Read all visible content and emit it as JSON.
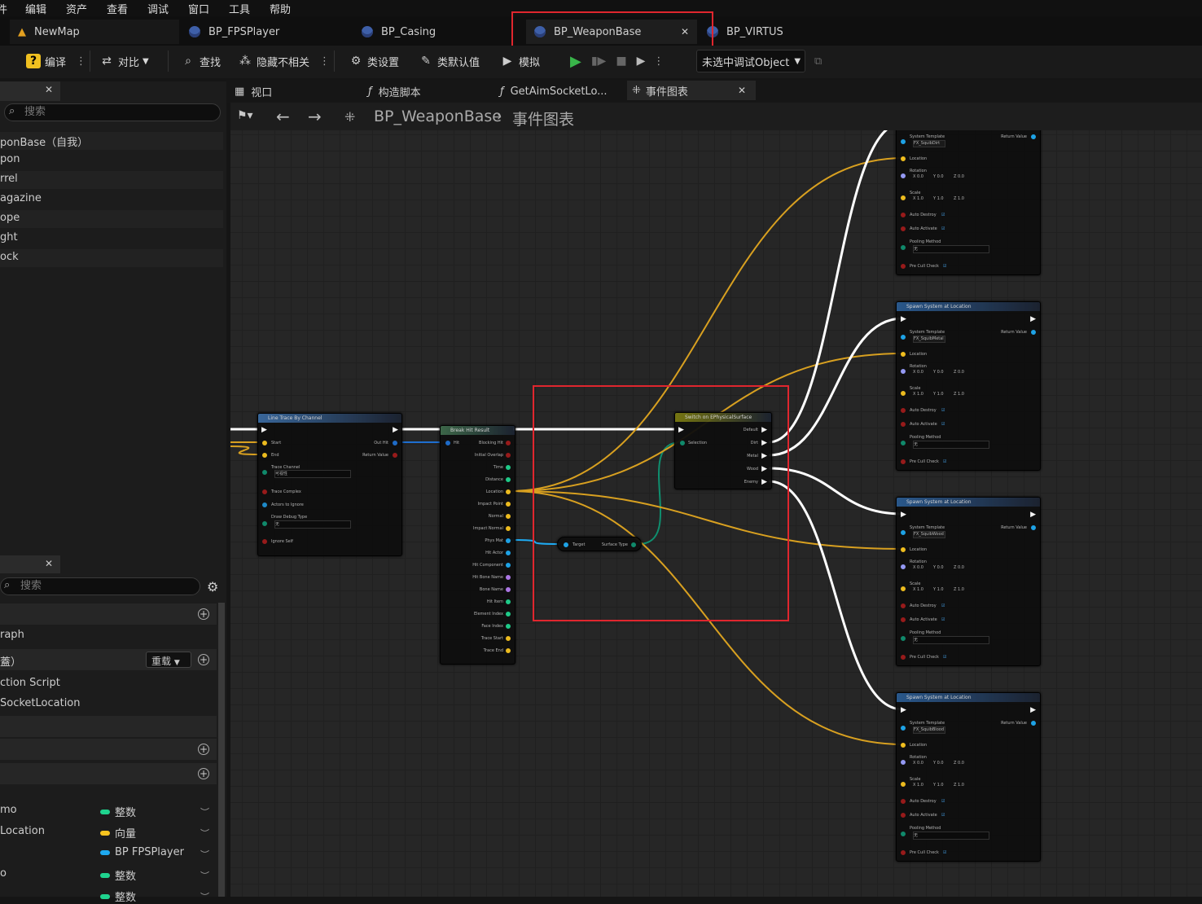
{
  "menu": [
    "件",
    "编辑",
    "资产",
    "查看",
    "调试",
    "窗口",
    "工具",
    "帮助"
  ],
  "tabs": [
    {
      "label": "NewMap"
    },
    {
      "label": "BP_FPSPlayer"
    },
    {
      "label": "BP_Casing"
    },
    {
      "label": "BP_WeaponBase"
    },
    {
      "label": "BP_VIRTUS"
    }
  ],
  "toolbar": {
    "compile": "编译",
    "diff": "对比",
    "find": "查找",
    "hide_unrelated": "隐藏不相关",
    "class_settings": "类设置",
    "class_defaults": "类默认值",
    "simulate": "模拟",
    "debug_object": "未选中调试Object"
  },
  "left_panel": {
    "search_placeholder": "搜索",
    "components": [
      "ponBase（自我）",
      "pon",
      "rrel",
      "agazine",
      "ope",
      "ght",
      "ock"
    ],
    "search2_placeholder": "搜索",
    "mb_rows": [
      "raph",
      "蓋）",
      "ction Script",
      "SocketLocation"
    ],
    "override_label": "重载",
    "variables": [
      {
        "name": "mo",
        "type": "整数",
        "color": "#1fd38e"
      },
      {
        "name": "Location",
        "type": "向量",
        "color": "#f7c31f"
      },
      {
        "name": "",
        "type": "BP FPSPlayer",
        "color": "#1ea9f0"
      },
      {
        "name": "o",
        "type": "整数",
        "color": "#1fd38e"
      },
      {
        "name": "",
        "type": "整数",
        "color": "#1fd38e"
      }
    ]
  },
  "graph_tabs": [
    "视口",
    "构造脚本",
    "GetAimSocketLo...",
    "事件图表"
  ],
  "breadcrumb": {
    "blueprint": "BP_WeaponBase",
    "graph": "事件图表"
  },
  "nodes": {
    "line_trace": {
      "title": "Line Trace By Channel",
      "pins": [
        "Start",
        "End",
        "Trace Channel",
        "Trace Complex",
        "Actors to Ignore",
        "Draw Debug Type",
        "Ignore Self"
      ],
      "out": [
        "Out Hit",
        "Return Value"
      ],
      "channel": "可视性",
      "debug": "无"
    },
    "break_hit": {
      "title": "Break Hit Result",
      "in": "Hit",
      "out": [
        "Blocking Hit",
        "Initial Overlap",
        "Time",
        "Distance",
        "Location",
        "Impact Point",
        "Normal",
        "Impact Normal",
        "Phys Mat",
        "Hit Actor",
        "Hit Component",
        "Hit Bone Name",
        "Bone Name",
        "Hit Item",
        "Element Index",
        "Face Index",
        "Trace Start",
        "Trace End"
      ]
    },
    "surface_type": {
      "in": "Target",
      "out": "Surface Type"
    },
    "switch": {
      "title": "Switch on EPhysicalSurface",
      "in": "Selection",
      "out": [
        "Default",
        "Dirt",
        "Metal",
        "Wood",
        "Enemy"
      ]
    },
    "spawn": {
      "title": "Spawn System at Location",
      "labels": [
        "System Template",
        "Return Value",
        "Location",
        "Rotation",
        "Scale",
        "Auto Destroy",
        "Auto Activate",
        "Pooling Method",
        "Pre Cull Check"
      ],
      "templates": [
        "FX_SquibDirt",
        "FX_SquibMetal",
        "FX_SquibWood",
        "FX_SquibBlood"
      ],
      "rot": "0.0",
      "scale": "1.0",
      "pool": "无"
    }
  }
}
